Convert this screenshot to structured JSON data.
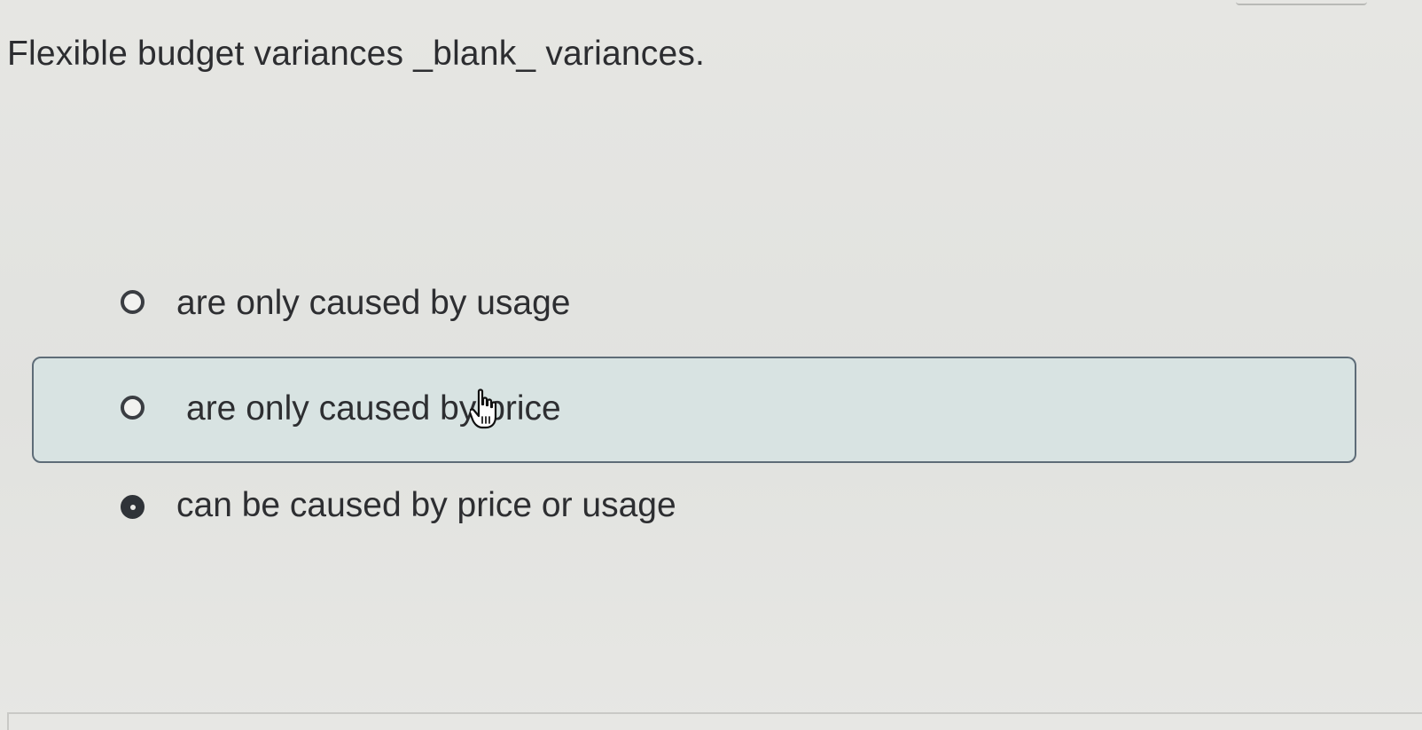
{
  "question": {
    "text": "Flexible budget variances _blank_ variances."
  },
  "options": [
    {
      "label": "are only caused by usage",
      "selected": false,
      "hovered": false
    },
    {
      "label": "are only caused by price",
      "selected": false,
      "hovered": true
    },
    {
      "label": "can be caused by price or usage",
      "selected": true,
      "hovered": false
    }
  ],
  "icons": {
    "radio": "radio-button-icon",
    "cursor": "hand-pointer-icon"
  },
  "colors": {
    "hover_background": "#d8e3e2",
    "hover_border": "#5e6c78",
    "radio": "#3a3d42"
  }
}
